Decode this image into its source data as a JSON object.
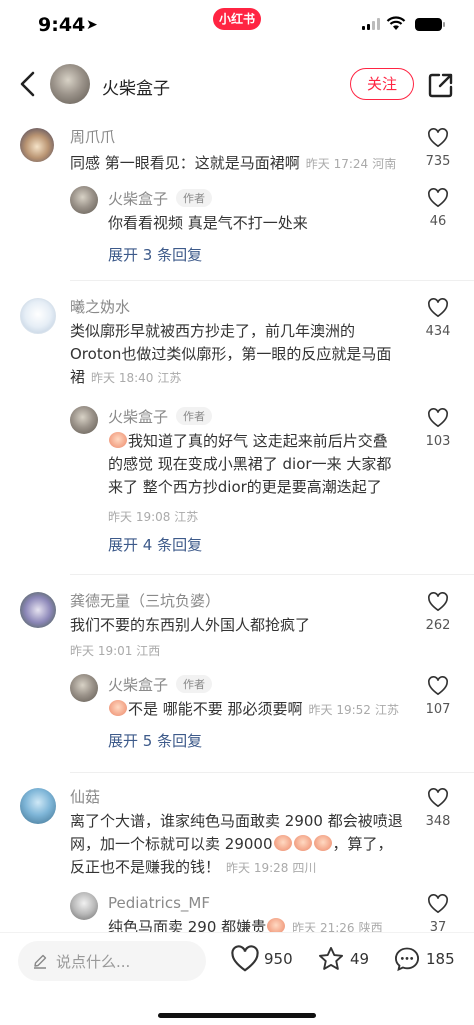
{
  "status_bar": {
    "time": "9:44",
    "app_badge": "小红书"
  },
  "header": {
    "title": "火柴盒子",
    "follow_label": "关注"
  },
  "comments": [
    {
      "name": "周爪爪",
      "text": "同感 第一眼看见：这就是马面裙啊",
      "time": "昨天 17:24",
      "location": "河南",
      "likes": "735",
      "reply": {
        "name": "火柴盒子",
        "author_tag": "作者",
        "text": "你看看视频 真是气不打一处来",
        "likes": "46"
      },
      "expand": "展开 3 条回复"
    },
    {
      "name": "曦之妫水",
      "text_lines": [
        "类似廓形早就被西方抄走了，前几年澳洲的",
        "Oroton也做过类似廓形，第一眼的反应就是马面",
        "裙"
      ],
      "time": "昨天 18:40",
      "location": "江苏",
      "likes": "434",
      "reply": {
        "name": "火柴盒子",
        "author_tag": "作者",
        "text_lines": [
          "我知道了真的好气 这走起来前后片交叠",
          "的感觉 现在变成小黑裙了 dior一来 大家都",
          "来了 整个西方抄dior的更是要高潮迭起了"
        ],
        "time": "昨天 19:08",
        "location": "江苏",
        "likes": "103"
      },
      "expand": "展开 4 条回复"
    },
    {
      "name": "龚德无量（三坑负婆）",
      "text": "我们不要的东西别人外国人都抢疯了",
      "time": "昨天 19:01",
      "location": "江西",
      "likes": "262",
      "reply": {
        "name": "火柴盒子",
        "author_tag": "作者",
        "text": "不是 哪能不要 那必须要啊",
        "time": "昨天 19:52",
        "location": "江苏",
        "likes": "107"
      },
      "expand": "展开 5 条回复"
    },
    {
      "name": "仙菇",
      "text_lines": [
        "离了个大谱，谁家纯色马面敢卖 2900 都会被喷退",
        "网，加一个标就可以卖 29000",
        "，算了，",
        "反正也不是赚我的钱！"
      ],
      "time": "昨天 19:28",
      "location": "四川",
      "likes": "348",
      "reply": {
        "name": "Pediatrics_MF",
        "text": "纯色马面卖 290 都嫌贵",
        "time": "昨天 21:26",
        "location": "陕西",
        "likes": "37"
      }
    }
  ],
  "bottom_bar": {
    "placeholder": "说点什么...",
    "likes": "950",
    "favorites": "49",
    "comments": "185"
  },
  "colors": {
    "brand": "#ff2442",
    "link": "#3d5a8a"
  },
  "icons": [
    "back-arrow-icon",
    "share-icon",
    "heart-icon",
    "star-icon",
    "comment-bubble-icon",
    "pencil-icon"
  ]
}
